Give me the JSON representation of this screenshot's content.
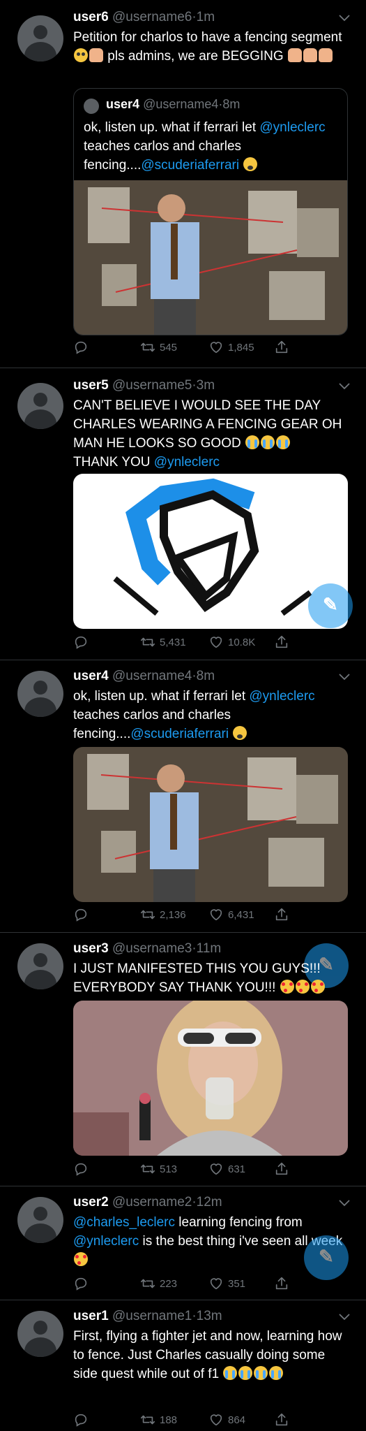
{
  "icons": {
    "reply": "reply-icon",
    "retweet": "retweet-icon",
    "like": "heart-icon",
    "share": "share-icon",
    "more": "chevron-down-icon",
    "compose": "compose-feather-icon"
  },
  "colors": {
    "accent": "#1d9bf0",
    "muted": "#71767b",
    "background": "#000000",
    "divider": "#2f3336"
  },
  "tweets": [
    {
      "name": "user6",
      "handle": "@username6",
      "sep": "·",
      "time": "1m",
      "text": [
        "Petition for charlos to have a fencing segment ",
        " pls admins, we are BEGGING "
      ],
      "quote": {
        "name": "user4",
        "handle": "@username4",
        "sep": "·",
        "time": "8m",
        "text_a": "ok, listen up. what if ferrari let ",
        "mention_a": "@ynleclerc",
        "text_b": " teaches carlos and charles fencing....",
        "mention_b": "@scuderiaferrari"
      },
      "retweets": "545",
      "likes": "1,845"
    },
    {
      "name": "user5",
      "handle": "@username5",
      "sep": "·",
      "time": "3m",
      "text": [
        "CAN'T BELIEVE I WOULD SEE THE DAY CHARLES WEARING A FENCING GEAR OH MAN HE LOOKS SO GOOD ",
        "THANK YOU "
      ],
      "mention": "@ynleclerc",
      "retweets": "5,431",
      "likes": "10.8K"
    },
    {
      "name": "user4",
      "handle": "@username4",
      "sep": "·",
      "time": "8m",
      "text_a": "ok, listen up. what if ferrari let ",
      "mention_a": "@ynleclerc",
      "text_b": " teaches carlos and charles fencing....",
      "mention_b": "@scuderiaferrari",
      "retweets": "2,136",
      "likes": "6,431"
    },
    {
      "name": "user3",
      "handle": "@username3",
      "sep": "·",
      "time": "11m",
      "text": "I JUST MANIFESTED THIS YOU GUYS!!! EVERYBODY SAY THANK YOU!!! ",
      "retweets": "513",
      "likes": "631"
    },
    {
      "name": "user2",
      "handle": "@username2",
      "sep": "·",
      "time": "12m",
      "mention_a": "@charles_leclerc",
      "text_a": " learning fencing from ",
      "mention_b": "@ynleclerc",
      "text_b": " is the best thing i've seen all week ",
      "retweets": "223",
      "likes": "351"
    },
    {
      "name": "user1",
      "handle": "@username1",
      "sep": "·",
      "time": "13m",
      "text": "First, flying a fighter jet and now, learning how to fence. Just Charles casually doing some side quest while out of f1 ",
      "retweets": "188",
      "likes": "864"
    }
  ]
}
